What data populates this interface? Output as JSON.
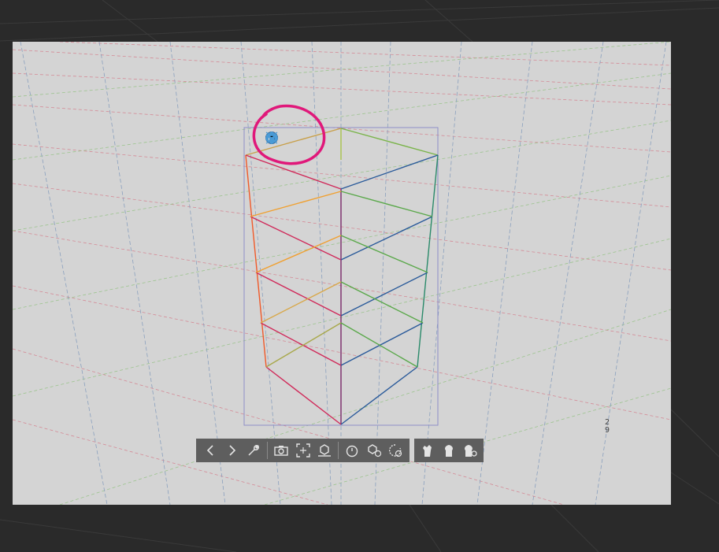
{
  "colors": {
    "outer_background": "#2a2a2a",
    "canvas_background": "#d4d4d4",
    "toolbar_background": "#5e5e5e",
    "annotation_circle": "#e0187a",
    "gizmo_icon": "#4a9bd6",
    "selection_box": "#8e8ec8"
  },
  "gizmo_toolbar": {
    "buttons": [
      {
        "name": "rotate-camera-icon"
      },
      {
        "name": "move-icon"
      },
      {
        "name": "pan-icon"
      },
      {
        "name": "move-along-plane-icon"
      },
      {
        "name": "rotate-object-icon"
      },
      {
        "name": "rotate-along-plane-icon"
      },
      {
        "name": "rotate-on-axis-icon"
      },
      {
        "name": "scale-icon"
      }
    ]
  },
  "bottom_toolbar": {
    "main": [
      {
        "name": "previous-icon"
      },
      {
        "name": "next-icon"
      },
      {
        "name": "wrench-icon"
      },
      {
        "name": "camera-icon"
      },
      {
        "name": "fit-to-view-icon"
      },
      {
        "name": "ground-object-icon"
      },
      {
        "name": "stopwatch-icon"
      },
      {
        "name": "reset-object-icon"
      },
      {
        "name": "reset-rotation-icon"
      }
    ],
    "pose": [
      {
        "name": "hand-pose-icon"
      },
      {
        "name": "hand-grip-icon"
      },
      {
        "name": "hand-settings-icon"
      }
    ]
  },
  "page_indicator": {
    "top": "2",
    "bottom": "9"
  }
}
